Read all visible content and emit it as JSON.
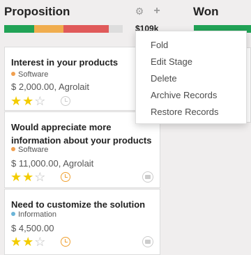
{
  "columns": {
    "proposition": {
      "title": "Proposition",
      "amount": "$109k",
      "progress": [
        {
          "color": "#21a356",
          "fraction": 0.25
        },
        {
          "color": "#f0ad4e",
          "fraction": 0.25
        },
        {
          "color": "#e05a5a",
          "fraction": 0.38
        },
        {
          "color": "#dddddd",
          "fraction": 0.12
        }
      ]
    },
    "won": {
      "title": "Won",
      "bar_color": "#21a356"
    }
  },
  "icons": {
    "gear": "⚙",
    "plus": "+"
  },
  "cards": [
    {
      "title": "Interest in your products",
      "tag": "Software",
      "tag_color": "#f0a050",
      "price": "$ 2,000.00, Agrolait",
      "stars": 2,
      "clock": "gray"
    },
    {
      "title": "Would appreciate more information about your products",
      "tag": "Software",
      "tag_color": "#f0a050",
      "price": "$ 11,000.00, Agrolait",
      "stars": 2,
      "clock": "orange"
    },
    {
      "title": "Need to customize the solution",
      "tag": "Information",
      "tag_color": "#6cb5d8",
      "price": "$ 4,500.00",
      "stars": 2,
      "clock": "orange"
    }
  ],
  "stage_menu": {
    "items": [
      "Fold",
      "Edit Stage",
      "Delete",
      "Archive Records",
      "Restore Records"
    ]
  }
}
